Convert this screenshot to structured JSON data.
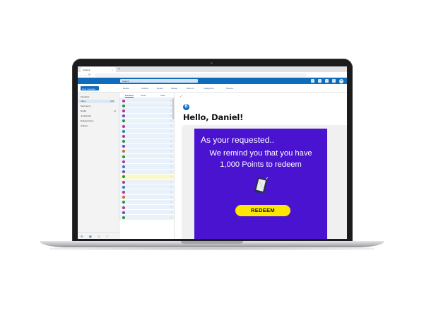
{
  "browser": {
    "tab_title": "Outlook",
    "tab_close": "×",
    "tab_new": "+",
    "back": "←",
    "forward": "→",
    "reload": "⟳"
  },
  "outlook": {
    "search_placeholder": "Search",
    "avatar_initials": "DB",
    "new_message": "New message",
    "commands": [
      "Delete",
      "Archive",
      "Report",
      "Sweep",
      "Move to",
      "Categorize",
      "Snooze"
    ],
    "folders_header": "Favorites",
    "folders": [
      {
        "label": "Inbox",
        "count": "248"
      },
      {
        "label": "Sent Items",
        "count": ""
      },
      {
        "label": "Drafts",
        "count": "11"
      },
      {
        "label": "Junk Email",
        "count": ""
      },
      {
        "label": "Deleted Items",
        "count": ""
      },
      {
        "label": "Archive",
        "count": ""
      }
    ],
    "list_tabs": [
      "Focused",
      "Other",
      "Filter"
    ],
    "dot_colors": [
      "#b8308e",
      "#2a8f3a",
      "#b8308e",
      "#7d3fb8",
      "#2a8f3a",
      "#b8308e",
      "#2a7fb8",
      "#b8308e",
      "#2a8f3a",
      "#7d3fb8",
      "#d26b12",
      "#2a8f3a",
      "#b8308e",
      "#2a7fb8",
      "#7d3fb8",
      "#2a8f3a",
      "#b8308e",
      "#2a7fb8",
      "#b8308e",
      "#d26b12",
      "#2a8f3a",
      "#b8308e",
      "#7d3fb8",
      "#2a8f3a"
    ],
    "highlight_row": 15,
    "sender_initial": "B",
    "greeting": "Hello, Daniel!"
  },
  "promo": {
    "line1": "As your requested..",
    "line2": "We remind you that you have",
    "line3": "1,000 Points to redeem",
    "button": "REDEEM",
    "bg_color": "#4a13d0",
    "button_color": "#ffe600"
  },
  "icons": {
    "tablet": "tablet-icon",
    "back": "back-arrow-icon",
    "forward": "forward-arrow-icon",
    "reload": "reload-icon"
  }
}
